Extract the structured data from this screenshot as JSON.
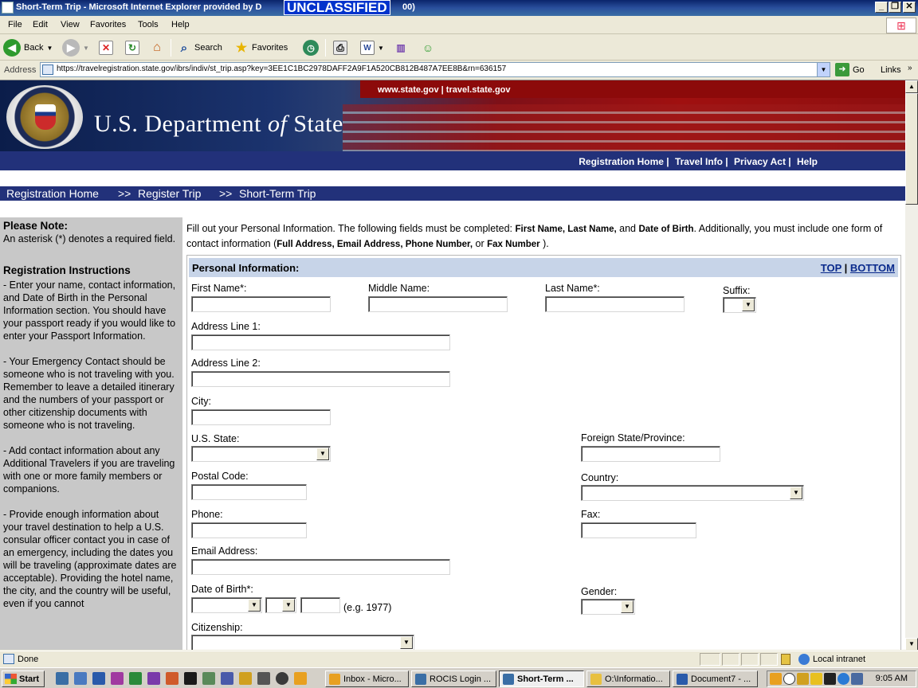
{
  "window": {
    "title": "Short-Term Trip - Microsoft Internet Explorer provided by D",
    "title_tail": "00)",
    "classification": "UNCLASSIFIED"
  },
  "menu": [
    "File",
    "Edit",
    "View",
    "Favorites",
    "Tools",
    "Help"
  ],
  "toolbar": {
    "back": "Back",
    "search": "Search",
    "favorites": "Favorites"
  },
  "addressbar": {
    "label": "Address",
    "url": "https://travelregistration.state.gov/ibrs/indiv/st_trip.asp?key=3EE1C1BC2978DAFF2A9F1A520CB812B487A7EE8B&rn=636157",
    "go": "Go",
    "links": "Links"
  },
  "banner": {
    "sitelinks": "www.state.gov | travel.state.gov",
    "heading_main": "U.S. Department ",
    "heading_of": "of",
    "heading_end": " State"
  },
  "topnav": [
    "Registration Home |",
    "Travel Info |",
    "Privacy Act |",
    "Help"
  ],
  "breadcrumb": [
    "Registration Home",
    ">>",
    "Register Trip",
    ">>",
    "Short-Term Trip"
  ],
  "sidebar": {
    "note_title": "Please Note:",
    "note_text": "An asterisk (*) denotes a required field.",
    "instructions_title": "Registration Instructions",
    "paragraphs": [
      "- Enter your name, contact information, and Date of Birth in the Personal Information section. You should have your passport ready if you would like to enter your Passport Information.",
      "- Your Emergency Contact should be someone who is not traveling with you. Remember to leave a detailed itinerary and the numbers of your passport or other citizenship documents with someone who is not traveling.",
      "- Add contact information about any Additional Travelers if you are traveling with one or more family members or companions.",
      "- Provide enough information about your travel destination to help a U.S. consular officer contact you in case of an emergency, including the dates you will be traveling (approximate dates are acceptable). Providing the hotel name, the city, and the country will be useful, even if you cannot"
    ]
  },
  "intro": {
    "part1": "Fill out your Personal Information. The following fields must be completed: ",
    "b1": "First Name, Last Name,",
    "part2": " and ",
    "b2": "Date of Birth",
    "part3": ". Additionally, you must include one form of contact information (",
    "b3": "Full Address, Email Address, Phone Number,",
    "part4": " or ",
    "b4": "Fax Number",
    "part5": " )."
  },
  "personal_info": {
    "header": "Personal Information:",
    "top_link": "TOP",
    "separator": "|",
    "bottom_link": "BOTTOM",
    "labels": {
      "first_name": "First Name*:",
      "middle_name": "Middle Name:",
      "last_name": "Last Name*:",
      "suffix": "Suffix:",
      "address1": "Address Line 1:",
      "address2": "Address Line 2:",
      "city": "City:",
      "us_state": "U.S. State:",
      "foreign_state": "Foreign State/Province:",
      "postal_code": "Postal Code:",
      "country": "Country:",
      "phone": "Phone:",
      "fax": "Fax:",
      "email": "Email Address:",
      "dob": "Date of Birth*:",
      "dob_hint": "(e.g. 1977)",
      "gender": "Gender:",
      "citizenship": "Citizenship:"
    }
  },
  "statusbar": {
    "status": "Done",
    "zone": "Local intranet"
  },
  "taskbar": {
    "start": "Start",
    "tasks": [
      "Inbox - Micro...",
      "ROCIS Login ...",
      "Short-Term ...",
      "O:\\Informatio...",
      "Document7 - ..."
    ],
    "clock": "9:05 AM"
  },
  "colors": {
    "nav_blue": "#22317a",
    "panel_header": "#c7d4e8",
    "sidebar_gray": "#c8c8c8",
    "banner_red": "#8c0a0a"
  }
}
